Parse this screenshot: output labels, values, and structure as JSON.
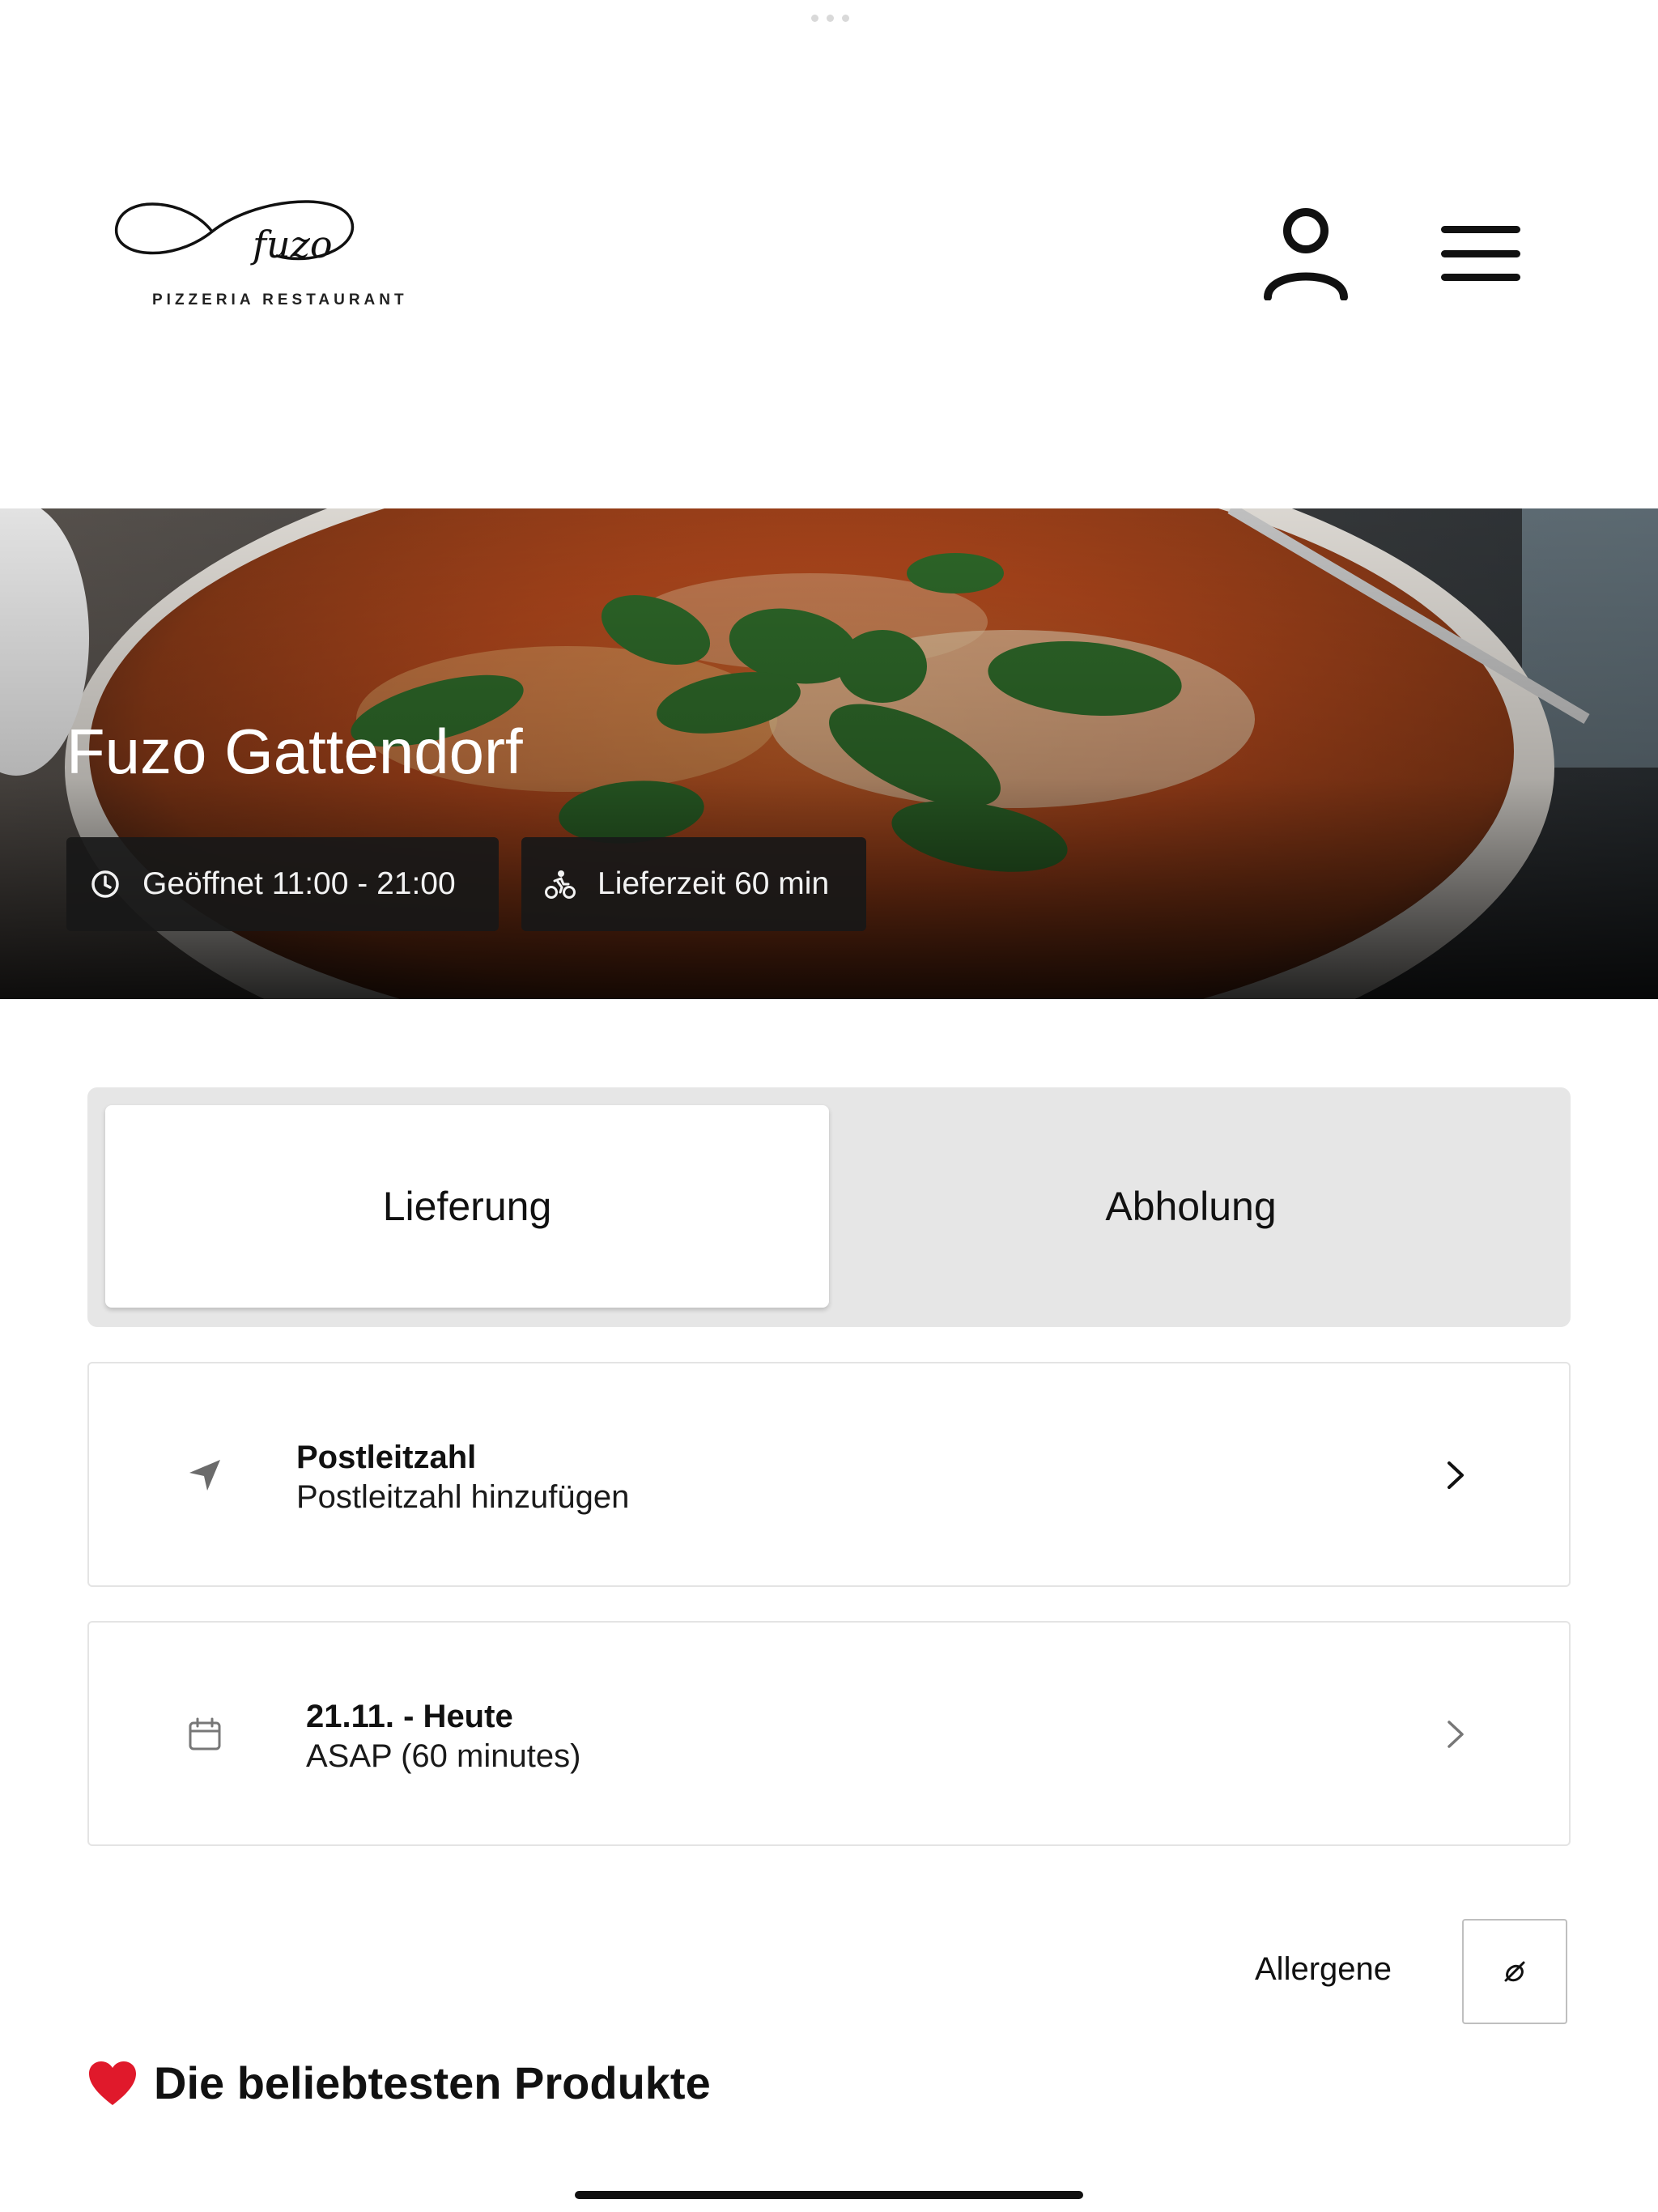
{
  "brand": {
    "logo_script": "fuzo",
    "logo_subtitle": "PIZZERIA RESTAURANT"
  },
  "header": {
    "icons": [
      "user-icon",
      "hamburger-menu-icon"
    ]
  },
  "hero": {
    "title": "Fuzo Gattendorf",
    "opening_hours": "Geöffnet 11:00 - 21:00",
    "delivery_time": "Lieferzeit 60 min",
    "icons": [
      "clock-icon",
      "delivery-bike-icon"
    ]
  },
  "order_mode": {
    "options": [
      "Lieferung",
      "Abholung"
    ],
    "selected": "Lieferung"
  },
  "postcode": {
    "title": "Postleitzahl",
    "subtitle": "Postleitzahl hinzufügen",
    "icon": "location-arrow-icon"
  },
  "schedule": {
    "title": "21.11. - Heute",
    "subtitle": "ASAP (60 minutes)",
    "icon": "calendar-icon"
  },
  "allergens": {
    "label": "Allergene",
    "icon": "allergen-icon"
  },
  "section": {
    "heading": "Die beliebtesten Produkte",
    "icon": "heart-icon"
  },
  "colors": {
    "chip_background": "#181818",
    "toggle_background": "#e6e6e6",
    "card_border": "#e4e4e4",
    "heart": "#e0192b"
  }
}
